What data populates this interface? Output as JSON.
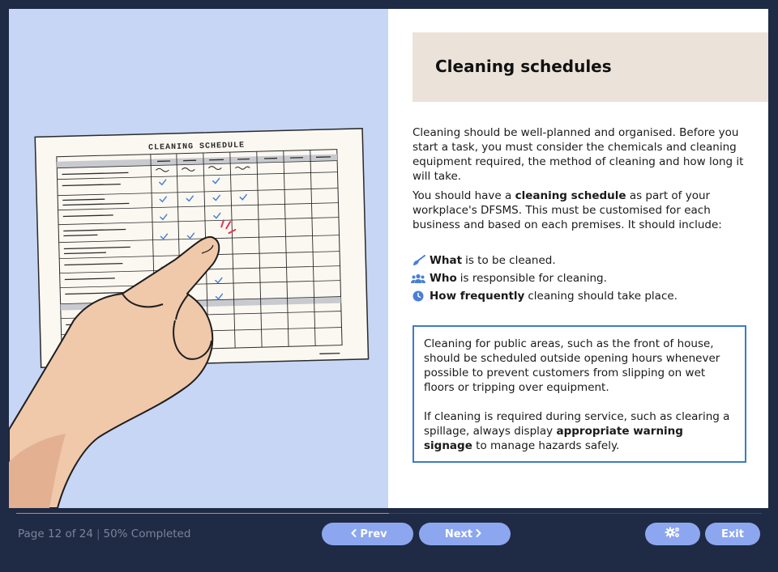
{
  "content": {
    "title": "Cleaning schedules",
    "schedule_heading": "CLEANING SCHEDULE",
    "paragraph1": "Cleaning should be well-planned and organised. Before you start a task, you must consider the chemicals and cleaning equipment required, the method of cleaning and how long it will take.",
    "paragraph2": {
      "before": "You should have a ",
      "bold": "cleaning schedule",
      "after": " as part of your workplace's DFSMS. This must be customised for each business and based on each premises. It should include:"
    },
    "bullets": [
      {
        "icon": "broom-icon",
        "bold": "What",
        "text": "is to be cleaned."
      },
      {
        "icon": "people-icon",
        "bold": "Who",
        "text": "is responsible for cleaning."
      },
      {
        "icon": "clock-icon",
        "bold": "How frequently",
        "text": "cleaning should take place."
      }
    ],
    "note": {
      "p1": "Cleaning for public areas, such as the front of house, should be scheduled outside opening hours whenever possible to prevent customers from slipping on wet floors or tripping over equipment.",
      "p2_before": "If cleaning is required during service, such as clearing a spillage, always display ",
      "p2_bold": "appropriate warning signage",
      "p2_after": " to manage hazards safely."
    }
  },
  "footer": {
    "page_label": "Page 12 of 24",
    "separator": "|",
    "completed_label": "50% Completed",
    "progress": 0.5,
    "prev_label": "Prev",
    "next_label": "Next",
    "settings_icon": "gears-icon",
    "exit_label": "Exit"
  },
  "colors": {
    "accent_button": "#8ca7ef",
    "background": "#1f2a44",
    "illustration_bg": "#c7d6f5",
    "title_band": "#ebe3da",
    "note_border": "#3e7bc4",
    "icon_blue": "#4a7fd6",
    "progress_fill": "#c98a4e"
  }
}
